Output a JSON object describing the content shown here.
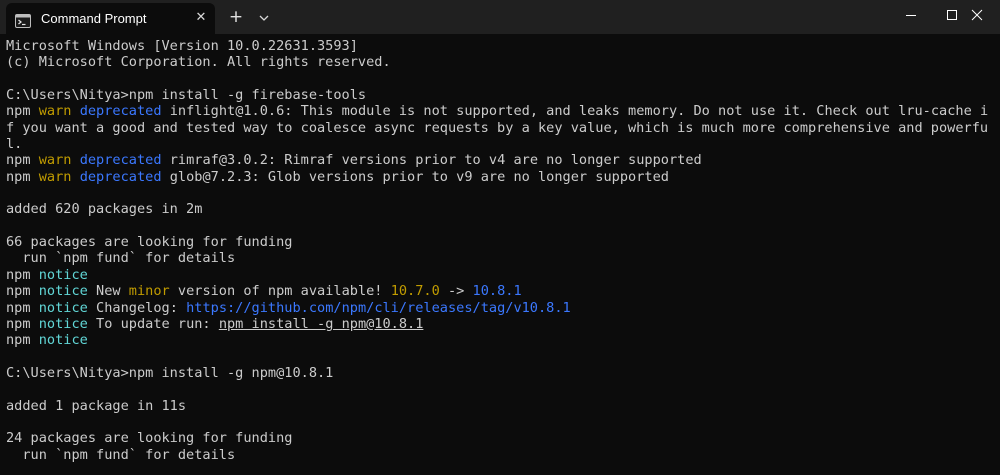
{
  "window": {
    "tab_title": "Command Prompt",
    "tab_icon": "terminal-icon",
    "new_tab_label": "+",
    "close_tab_label": "✕",
    "controls": [
      "minimize-icon",
      "maximize-icon",
      "close-icon"
    ]
  },
  "colors": {
    "background": "#0c0c0c",
    "titlebar": "#202020",
    "text": "#cccccc",
    "warn": "#c19c00",
    "deprecated": "#3b78ff",
    "notice": "#61d6d6"
  },
  "terminal": {
    "lines": [
      {
        "text": "Microsoft Windows [Version 10.0.22631.3593]"
      },
      {
        "text": "(c) Microsoft Corporation. All rights reserved."
      },
      {
        "text": ""
      },
      {
        "text": "C:\\Users\\Nitya>npm install -g firebase-tools"
      },
      {
        "segs": [
          {
            "t": "npm "
          },
          {
            "t": "warn",
            "c": "y"
          },
          {
            "t": " "
          },
          {
            "t": "deprecated",
            "c": "b"
          },
          {
            "t": " inflight@1.0.6: This module is not supported, and leaks memory. Do not use it. Check out lru-cache i"
          }
        ]
      },
      {
        "text": "f you want a good and tested way to coalesce async requests by a key value, which is much more comprehensive and powerfu"
      },
      {
        "text": "l."
      },
      {
        "segs": [
          {
            "t": "npm "
          },
          {
            "t": "warn",
            "c": "y"
          },
          {
            "t": " "
          },
          {
            "t": "deprecated",
            "c": "b"
          },
          {
            "t": " rimraf@3.0.2: Rimraf versions prior to v4 are no longer supported"
          }
        ]
      },
      {
        "segs": [
          {
            "t": "npm "
          },
          {
            "t": "warn",
            "c": "y"
          },
          {
            "t": " "
          },
          {
            "t": "deprecated",
            "c": "b"
          },
          {
            "t": " glob@7.2.3: Glob versions prior to v9 are no longer supported"
          }
        ]
      },
      {
        "text": ""
      },
      {
        "text": "added 620 packages in 2m"
      },
      {
        "text": ""
      },
      {
        "text": "66 packages are looking for funding"
      },
      {
        "text": "  run `npm fund` for details"
      },
      {
        "segs": [
          {
            "t": "npm "
          },
          {
            "t": "notice",
            "c": "c"
          }
        ]
      },
      {
        "segs": [
          {
            "t": "npm "
          },
          {
            "t": "notice",
            "c": "c"
          },
          {
            "t": " New "
          },
          {
            "t": "minor",
            "c": "y"
          },
          {
            "t": " version of npm available! "
          },
          {
            "t": "10.7.0",
            "c": "y"
          },
          {
            "t": " -> "
          },
          {
            "t": "10.8.1",
            "c": "b"
          }
        ]
      },
      {
        "segs": [
          {
            "t": "npm "
          },
          {
            "t": "notice",
            "c": "c"
          },
          {
            "t": " Changelog: "
          },
          {
            "t": "https://github.com/npm/cli/releases/tag/v10.8.1",
            "c": "b"
          }
        ]
      },
      {
        "segs": [
          {
            "t": "npm "
          },
          {
            "t": "notice",
            "c": "c"
          },
          {
            "t": " To update run: "
          },
          {
            "t": "npm install -g npm@10.8.1",
            "c": "u"
          }
        ]
      },
      {
        "segs": [
          {
            "t": "npm "
          },
          {
            "t": "notice",
            "c": "c"
          }
        ]
      },
      {
        "text": ""
      },
      {
        "text": "C:\\Users\\Nitya>npm install -g npm@10.8.1"
      },
      {
        "text": ""
      },
      {
        "text": "added 1 package in 11s"
      },
      {
        "text": ""
      },
      {
        "text": "24 packages are looking for funding"
      },
      {
        "text": "  run `npm fund` for details"
      }
    ]
  }
}
